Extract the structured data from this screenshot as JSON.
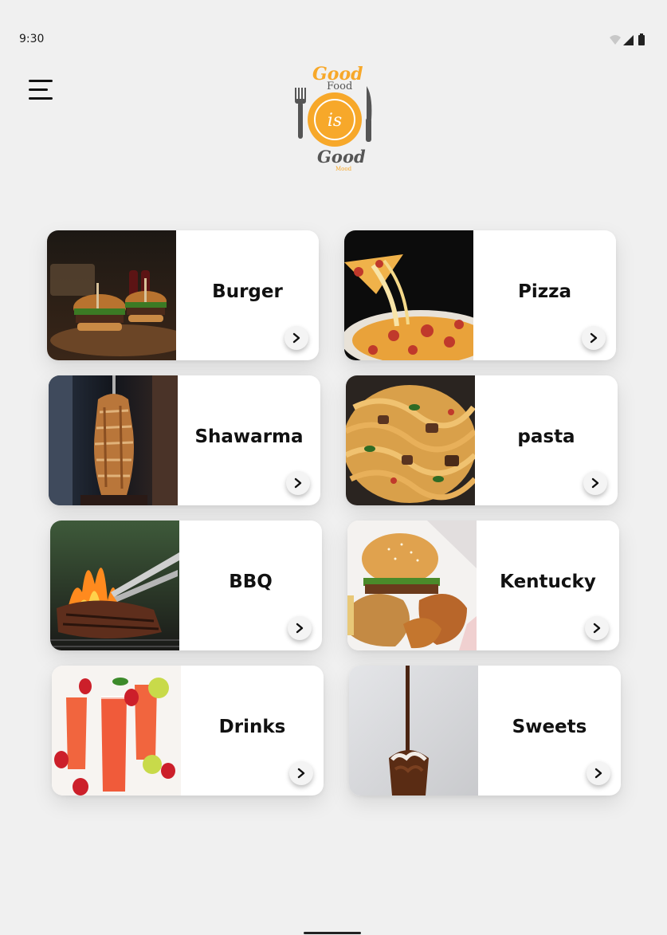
{
  "status": {
    "time": "9:30",
    "icons": [
      "wifi-icon",
      "signal-icon",
      "battery-icon"
    ]
  },
  "header": {
    "menu_icon": "hamburger-menu-icon",
    "logo": {
      "line1": "Good",
      "line2": "Food",
      "center": "is",
      "line3": "Good",
      "line4": "Mood"
    }
  },
  "colors": {
    "background": "#f0f0f0",
    "card": "#ffffff",
    "logo_orange": "#f7a82a",
    "logo_grey": "#555555",
    "text": "#111111"
  },
  "categories": [
    {
      "label": "Burger",
      "arrow_icon": "chevron-right-icon"
    },
    {
      "label": "Pizza",
      "arrow_icon": "chevron-right-icon"
    },
    {
      "label": "Shawarma",
      "arrow_icon": "chevron-right-icon"
    },
    {
      "label": "pasta",
      "arrow_icon": "chevron-right-icon"
    },
    {
      "label": "BBQ",
      "arrow_icon": "chevron-right-icon"
    },
    {
      "label": "Kentucky",
      "arrow_icon": "chevron-right-icon"
    },
    {
      "label": "Drinks",
      "arrow_icon": "chevron-right-icon"
    },
    {
      "label": "Sweets",
      "arrow_icon": "chevron-right-icon"
    }
  ]
}
